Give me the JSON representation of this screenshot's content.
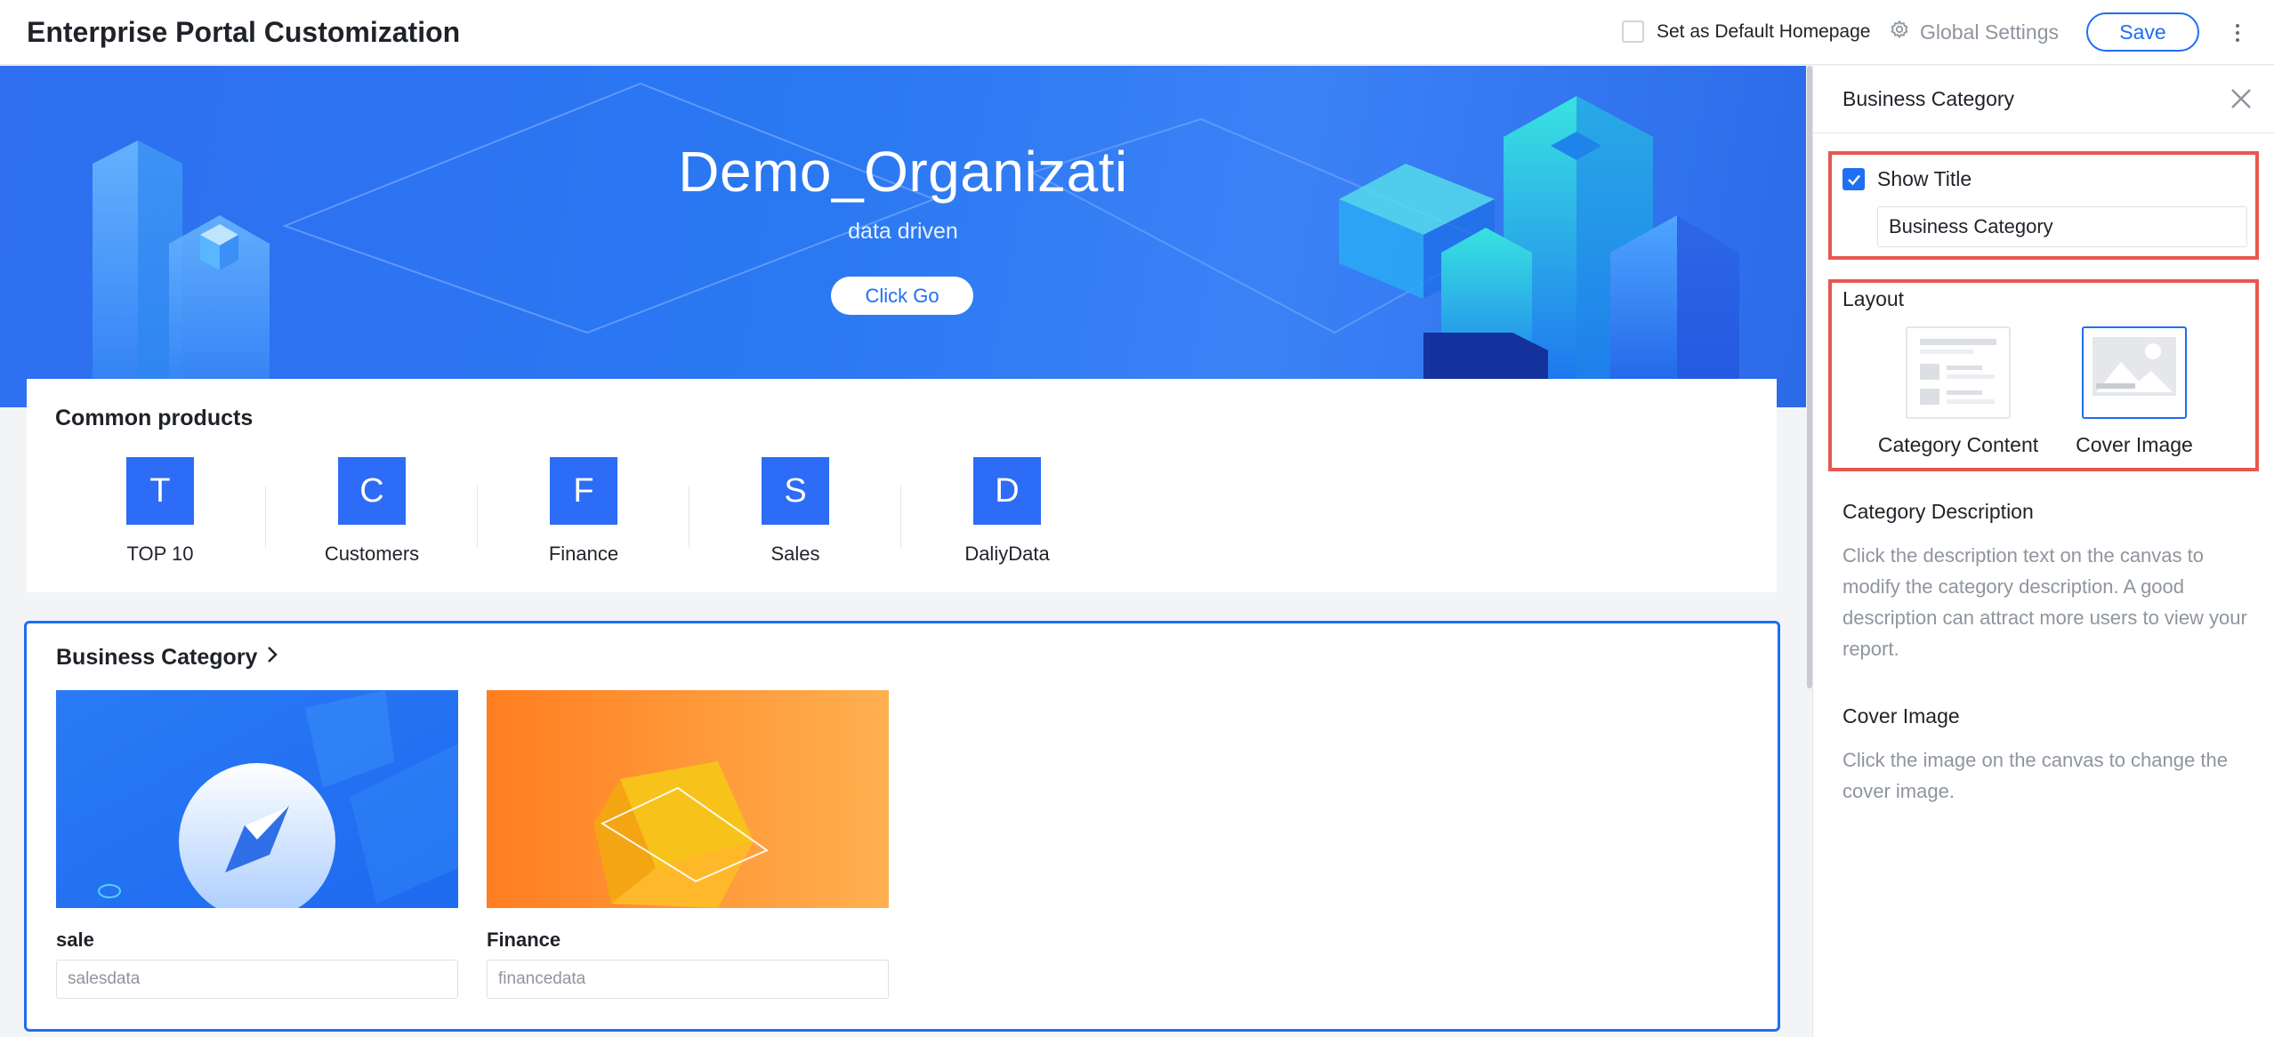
{
  "header": {
    "title": "Enterprise Portal Customization",
    "default_homepage_label": "Set as Default Homepage",
    "default_homepage_checked": false,
    "global_settings_label": "Global Settings",
    "save_label": "Save"
  },
  "hero": {
    "title": "Demo_Organizati",
    "subtitle": "data driven",
    "button_label": "Click Go"
  },
  "products": {
    "title": "Common products",
    "items": [
      {
        "letter": "T",
        "label": "TOP 10"
      },
      {
        "letter": "C",
        "label": "Customers"
      },
      {
        "letter": "F",
        "label": "Finance"
      },
      {
        "letter": "S",
        "label": "Sales"
      },
      {
        "letter": "D",
        "label": "DaliyData"
      }
    ]
  },
  "business": {
    "title": "Business Category",
    "items": [
      {
        "name": "sale",
        "description": "salesdata"
      },
      {
        "name": "Finance",
        "description": "financedata"
      }
    ]
  },
  "panel": {
    "title": "Business Category",
    "show_title_label": "Show Title",
    "show_title_checked": true,
    "title_value": "Business Category",
    "layout_label": "Layout",
    "layout_options": [
      {
        "label": "Category Content",
        "selected": false
      },
      {
        "label": "Cover Image",
        "selected": true
      }
    ],
    "category_description_heading": "Category Description",
    "category_description_text": "Click the description text on the canvas to modify the category description. A good description can attract more users to view your report.",
    "cover_image_heading": "Cover Image",
    "cover_image_text": "Click the image on the canvas to change the cover image."
  },
  "colors": {
    "accent": "#1e6ff1",
    "highlight": "#e95650",
    "tile": "#2c6cf6"
  }
}
